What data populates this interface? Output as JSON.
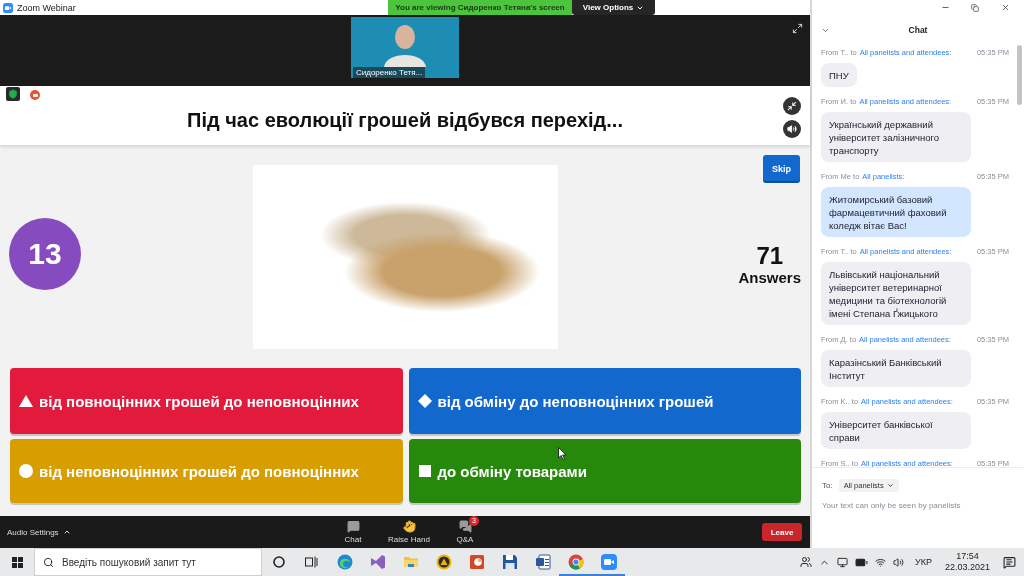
{
  "window": {
    "title": "Zoom Webinar"
  },
  "share_banner": {
    "text": "You are viewing Сидоренко Тетяна's screen",
    "button": "View Options"
  },
  "video": {
    "name": "Сидоренко Тетя..."
  },
  "quiz": {
    "question": "Під час еволюції грошей відбувся перехід...",
    "skip": "Skip",
    "timer": "13",
    "answer_count": "71",
    "answer_label": "Answers",
    "options": [
      {
        "kind": "triangle",
        "color": "#e21b3c",
        "text": "від повноцінних грошей до неповноцінних"
      },
      {
        "kind": "diamond",
        "color": "#1368ce",
        "text": "від обміну до неповноцінних грошей"
      },
      {
        "kind": "circle",
        "color": "#d89e00",
        "text": "від неповноцінних грошей до повноцінних"
      },
      {
        "kind": "square",
        "color": "#26890c",
        "text": "до обміну товарами"
      }
    ]
  },
  "toolbar": {
    "audio": "Audio Settings",
    "buttons": [
      {
        "kind": "chat",
        "label": "Chat"
      },
      {
        "kind": "hand",
        "label": "Raise Hand"
      },
      {
        "kind": "qa",
        "label": "Q&A",
        "badge": "3"
      }
    ],
    "leave": "Leave"
  },
  "chat": {
    "title": "Chat",
    "messages": [
      {
        "sender": "From T.. to",
        "recipient": "All panelists and attendees:",
        "time": "05:35 PM",
        "text": "ПНУ",
        "own": false
      },
      {
        "sender": "From И. to",
        "recipient": "All panelists and attendees:",
        "time": "05:35 PM",
        "text": "Український державний університет залізничного транспорту",
        "own": false
      },
      {
        "sender": "From Me to",
        "recipient": "All panelists:",
        "time": "05:35 PM",
        "text": "Житомирський базовий фармацевтичний фаховий коледж вітає Вас!",
        "own": true
      },
      {
        "sender": "From T.. to",
        "recipient": "All panelists and attendees:",
        "time": "05:35 PM",
        "text": "Львівський національний університет ветеринарної медицини та біотехнологій імені Степана Ґжицького",
        "own": false
      },
      {
        "sender": "From Д. to",
        "recipient": "All panelists and attendees:",
        "time": "05:35 PM",
        "text": "Каразінський Банківський Інститут",
        "own": false
      },
      {
        "sender": "From K.. to",
        "recipient": "All panelists and attendees:",
        "time": "05:35 PM",
        "text": "Університет банківської справи",
        "own": false
      },
      {
        "sender": "From S.. to",
        "recipient": "All panelists and attendees:",
        "time": "05:35 PM"
      }
    ],
    "to_label": "To:",
    "to_value": "All panelists",
    "note": "Your text can only be seen by panelists"
  },
  "taskbar": {
    "search_placeholder": "Введіть пошуковий запит тут",
    "apps": [
      {
        "kind": "swirl",
        "open": false
      },
      {
        "kind": "ribbon",
        "open": false
      },
      {
        "kind": "folder",
        "open": false
      },
      {
        "kind": "triangle_disc",
        "open": false
      },
      {
        "kind": "slides",
        "open": false
      },
      {
        "kind": "floppy",
        "open": false
      },
      {
        "kind": "document",
        "open": false
      },
      {
        "kind": "pinwheel",
        "open": true
      },
      {
        "kind": "camera",
        "open": true
      }
    ],
    "language": "УКР",
    "time": "17:54",
    "date": "22.03.2021"
  }
}
